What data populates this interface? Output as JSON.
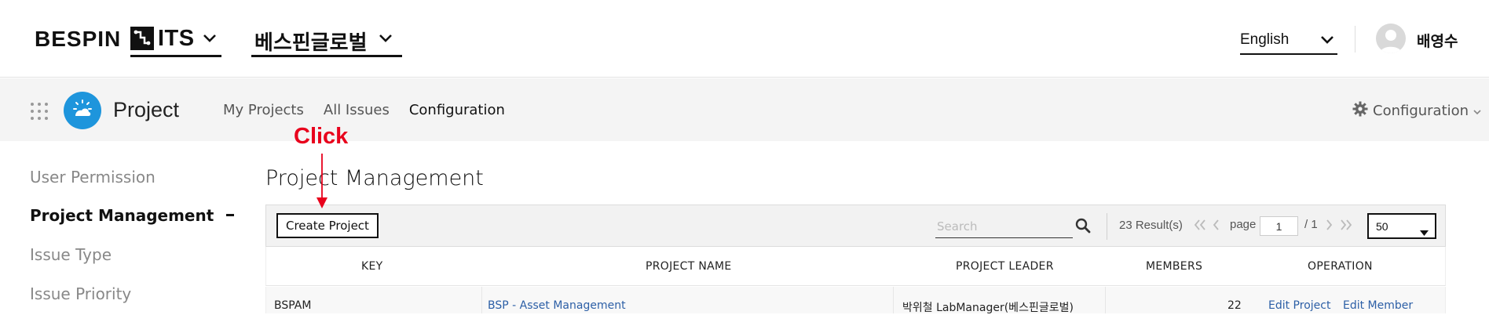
{
  "header": {
    "brand": "BESPIN",
    "product": "ITS",
    "organization": "베스핀글로벌",
    "language": "English",
    "user_name": "배영수"
  },
  "subnav": {
    "app_title": "Project",
    "tabs": [
      {
        "label": "My Projects",
        "active": false
      },
      {
        "label": "All Issues",
        "active": false
      },
      {
        "label": "Configuration",
        "active": true
      }
    ],
    "config_menu": "Configuration"
  },
  "sidebar": {
    "items": [
      {
        "label": "User Permission",
        "active": false
      },
      {
        "label": "Project Management",
        "active": true
      },
      {
        "label": "Issue Type",
        "active": false
      },
      {
        "label": "Issue Priority",
        "active": false
      }
    ]
  },
  "annotation": {
    "label": "Click",
    "color": "#e8001c"
  },
  "main": {
    "title": "Project Management",
    "create_button": "Create Project",
    "search_placeholder": "Search",
    "results": "23 Result(s)",
    "page_label": "page",
    "page_current": "1",
    "page_total": "/ 1",
    "per_page": "50",
    "columns": [
      "KEY",
      "PROJECT NAME",
      "PROJECT LEADER",
      "MEMBERS",
      "OPERATION"
    ],
    "rows": [
      {
        "key": "BSPAM",
        "name": "BSP - Asset Management",
        "leader": "박위철 LabManager(베스핀글로벌)",
        "members": "22",
        "edit_project": "Edit Project",
        "edit_member": "Edit Member"
      }
    ]
  },
  "colors": {
    "accent_blue": "#1e95dc",
    "link": "#2c5fa6",
    "subbar_bg": "#f4f4f4"
  }
}
